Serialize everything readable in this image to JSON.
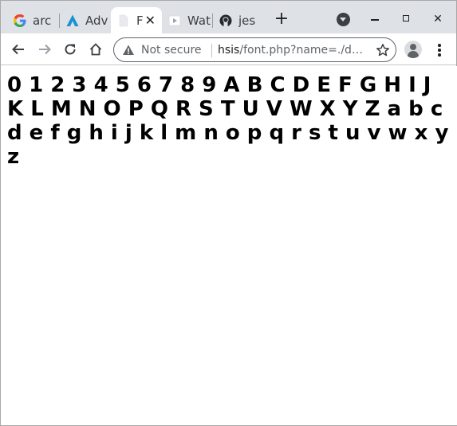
{
  "tabs": [
    {
      "title": "arc",
      "favicon": "google-icon",
      "active": false
    },
    {
      "title": "Adv",
      "favicon": "arc-logo-icon",
      "active": false
    },
    {
      "title": "F",
      "favicon": "blank-page-icon",
      "active": true
    },
    {
      "title": "Wat",
      "favicon": "video-icon",
      "active": false
    },
    {
      "title": "jes",
      "favicon": "github-icon",
      "active": false
    }
  ],
  "tab_close": "✕",
  "new_tab": "+",
  "window": {
    "close": "✕"
  },
  "address_bar": {
    "security_status": "Not secure",
    "host": "hsis",
    "path": "/font.php?name=./d…"
  },
  "content": {
    "glyph_text": "0 1 2 3 4 5 6 7 8 9 A B C D E F G H I J K L M N O P Q R S T U V W X Y Z a b c d e f g h i j k l m n o p q r s t u v w x y z"
  },
  "colors": {
    "tabstrip_bg": "#dee1e6",
    "toolbar_bg": "#ffffff",
    "text": "#202124"
  }
}
